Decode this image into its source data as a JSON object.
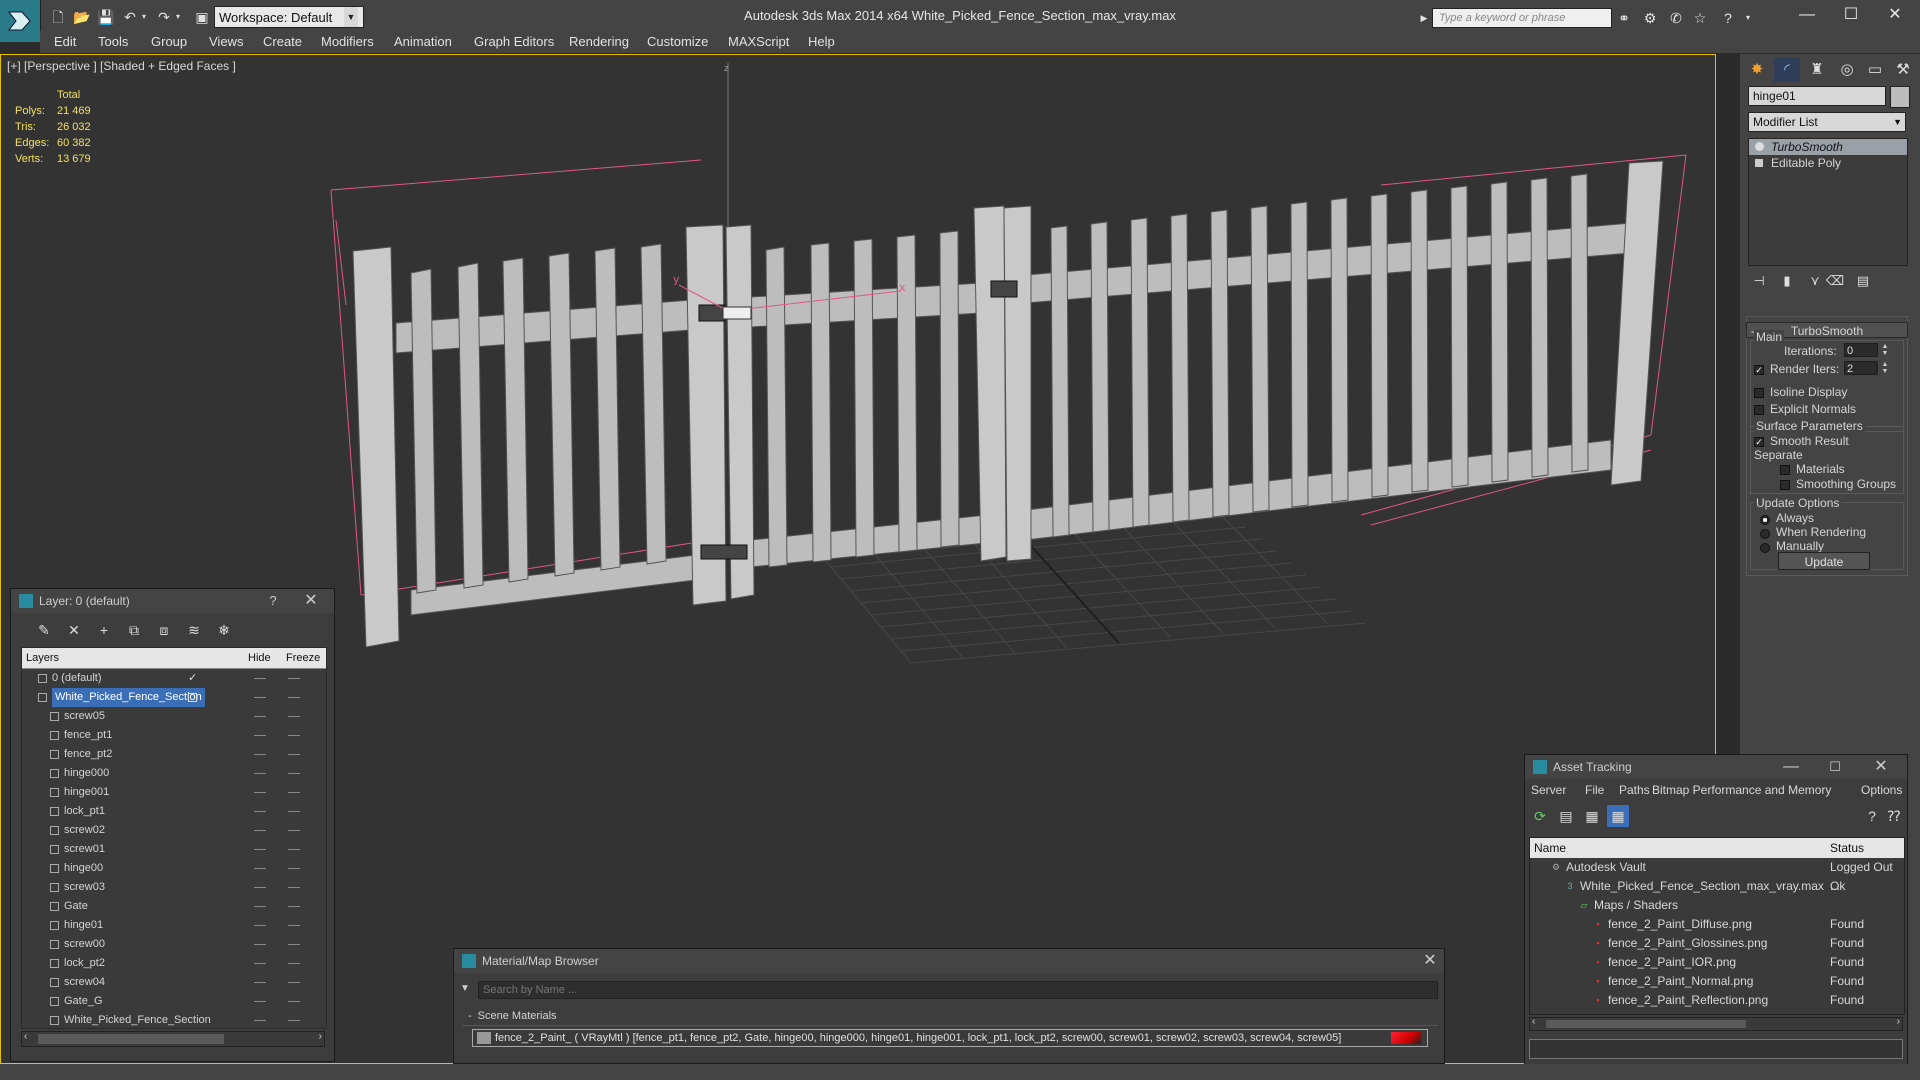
{
  "window": {
    "title": "Autodesk 3ds Max  2014 x64      White_Picked_Fence_Section_max_vray.max",
    "workspace_label": "Workspace: Default",
    "search_placeholder": "Type a keyword or phrase"
  },
  "menu": [
    "Edit",
    "Tools",
    "Group",
    "Views",
    "Create",
    "Modifiers",
    "Animation",
    "Graph Editors",
    "Rendering",
    "Customize",
    "MAXScript",
    "Help"
  ],
  "viewport": {
    "label": "[+] [Perspective ] [Shaded + Edged Faces ]",
    "stats": {
      "header": "Total",
      "rows": [
        {
          "k": "Polys:",
          "v": "21 469"
        },
        {
          "k": "Tris:",
          "v": "26 032"
        },
        {
          "k": "Edges:",
          "v": "60 382"
        },
        {
          "k": "Verts:",
          "v": "13 679"
        }
      ]
    },
    "axis_labels": {
      "z": "z",
      "y": "y",
      "x": "x"
    }
  },
  "command_panel": {
    "object_name": "hinge01",
    "modifier_list": "Modifier List",
    "stack": [
      "TurboSmooth",
      "Editable Poly"
    ],
    "turbosmooth": {
      "title": "TurboSmooth",
      "main": "Main",
      "iterations_label": "Iterations:",
      "iterations": "0",
      "render_iters_label": "Render Iters:",
      "render_iters": "2",
      "isoline": "Isoline Display",
      "explicit_normals": "Explicit Normals",
      "surface_params": "Surface Parameters",
      "smooth_result": "Smooth Result",
      "separate": "Separate",
      "materials": "Materials",
      "smoothing_groups": "Smoothing Groups",
      "update_options": "Update Options",
      "always": "Always",
      "when_rendering": "When Rendering",
      "manually": "Manually",
      "update": "Update"
    }
  },
  "layers": {
    "title": "Layer: 0 (default)",
    "help": "?",
    "close": "✕",
    "columns": {
      "layers": "Layers",
      "hide": "Hide",
      "freeze": "Freeze"
    },
    "rows": [
      {
        "name": "0 (default)",
        "level": 0
      },
      {
        "name": "White_Picked_Fence_Section",
        "level": 0
      },
      {
        "name": "screw05",
        "level": 1
      },
      {
        "name": "fence_pt1",
        "level": 1
      },
      {
        "name": "fence_pt2",
        "level": 1
      },
      {
        "name": "hinge000",
        "level": 1
      },
      {
        "name": "hinge001",
        "level": 1
      },
      {
        "name": "lock_pt1",
        "level": 1
      },
      {
        "name": "screw02",
        "level": 1
      },
      {
        "name": "screw01",
        "level": 1
      },
      {
        "name": "hinge00",
        "level": 1
      },
      {
        "name": "screw03",
        "level": 1
      },
      {
        "name": "Gate",
        "level": 1
      },
      {
        "name": "hinge01",
        "level": 1
      },
      {
        "name": "screw00",
        "level": 1
      },
      {
        "name": "lock_pt2",
        "level": 1
      },
      {
        "name": "screw04",
        "level": 1
      },
      {
        "name": "Gate_G",
        "level": 1
      },
      {
        "name": "White_Picked_Fence_Section",
        "level": 1
      }
    ]
  },
  "material_browser": {
    "title": "Material/Map Browser",
    "search_placeholder": "Search by Name ...",
    "section": "Scene Materials",
    "item": "fence_2_Paint_  ( VRayMtl )  [fence_pt1, fence_pt2, Gate, hinge00, hinge000, hinge01, hinge001, lock_pt1, lock_pt2, screw00, screw01, screw02, screw03, screw04, screw05]"
  },
  "asset_tracking": {
    "title": "Asset Tracking",
    "menu": [
      "Server",
      "File",
      "Paths",
      "Bitmap Performance and Memory",
      "Options"
    ],
    "columns": {
      "name": "Name",
      "status": "Status"
    },
    "rows": [
      {
        "name": "Autodesk Vault",
        "status": "Logged Out ...",
        "indent": 1
      },
      {
        "name": "White_Picked_Fence_Section_max_vray.max",
        "status": "Ok",
        "indent": 2
      },
      {
        "name": "Maps / Shaders",
        "status": "",
        "indent": 3
      },
      {
        "name": "fence_2_Paint_Diffuse.png",
        "status": "Found",
        "indent": 4
      },
      {
        "name": "fence_2_Paint_Glossines.png",
        "status": "Found",
        "indent": 4
      },
      {
        "name": "fence_2_Paint_IOR.png",
        "status": "Found",
        "indent": 4
      },
      {
        "name": "fence_2_Paint_Normal.png",
        "status": "Found",
        "indent": 4
      },
      {
        "name": "fence_2_Paint_Reflection.png",
        "status": "Found",
        "indent": 4
      }
    ]
  }
}
